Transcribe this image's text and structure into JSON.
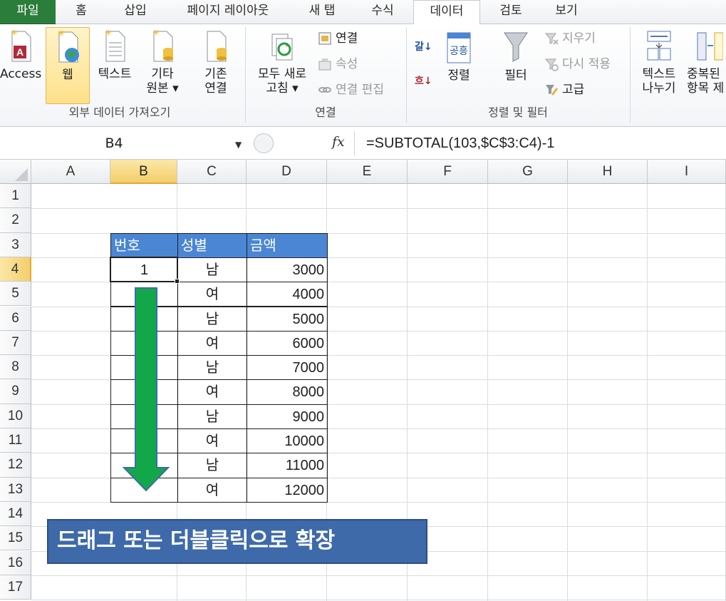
{
  "tabs": [
    {
      "label": "파일",
      "type": "file"
    },
    {
      "label": "홈"
    },
    {
      "label": "삽입"
    },
    {
      "label": "페이지 레이아웃"
    },
    {
      "label": "새 탭"
    },
    {
      "label": "수식"
    },
    {
      "label": "데이터",
      "active": true
    },
    {
      "label": "검토"
    },
    {
      "label": "보기"
    }
  ],
  "ribbon": {
    "external": {
      "group_label": "외부 데이터 가져오기",
      "access": "Access",
      "web": "웹",
      "text": "텍스트",
      "other_line1": "기타",
      "other_line2": "원본 ▾"
    },
    "existing": {
      "line1": "기존",
      "line2": "연결"
    },
    "connections": {
      "group_label": "연결",
      "refresh_line1": "모두 새로",
      "refresh_line2": "고침 ▾",
      "connections": "연결",
      "properties": "속성",
      "edit_links": "연결 편집"
    },
    "sortfilter": {
      "group_label": "정렬 및 필터",
      "sort": "정렬",
      "filter": "필터",
      "clear": "지우기",
      "reapply": "다시 적용",
      "advanced": "고급",
      "sort_icon_text": "공흥"
    },
    "tools": {
      "text_to_columns_line1": "텍스트",
      "text_to_columns_line2": "나누기",
      "remove_dup_line1": "중복된",
      "remove_dup_line2": "항목 제"
    }
  },
  "formula_bar": {
    "name_box": "B4",
    "fx": "fx",
    "formula": "=SUBTOTAL(103,$C$3:C4)-1"
  },
  "columns": [
    "A",
    "B",
    "C",
    "D",
    "E",
    "F",
    "G",
    "H",
    "I"
  ],
  "rows": [
    "1",
    "2",
    "3",
    "4",
    "5",
    "6",
    "7",
    "8",
    "9",
    "10",
    "11",
    "12",
    "13",
    "14",
    "15",
    "16",
    "17"
  ],
  "selected_cell": "B4",
  "table": {
    "headers": [
      "번호",
      "성별",
      "금액"
    ],
    "rows": [
      [
        "1",
        "남",
        "3000"
      ],
      [
        "",
        "여",
        "4000"
      ],
      [
        "",
        "남",
        "5000"
      ],
      [
        "",
        "여",
        "6000"
      ],
      [
        "",
        "남",
        "7000"
      ],
      [
        "",
        "여",
        "8000"
      ],
      [
        "",
        "남",
        "9000"
      ],
      [
        "",
        "여",
        "10000"
      ],
      [
        "",
        "남",
        "11000"
      ],
      [
        "",
        "여",
        "12000"
      ]
    ]
  },
  "annotation": {
    "banner_text": "드래그 또는 더블클릭으로 확장",
    "arrow_color": "#12a84a",
    "banner_color": "#3e6aa9"
  },
  "colors": {
    "file_tab": "#2b7d3b",
    "header_fill": "#4a86d4",
    "selected_header": "#f3cf6a"
  }
}
